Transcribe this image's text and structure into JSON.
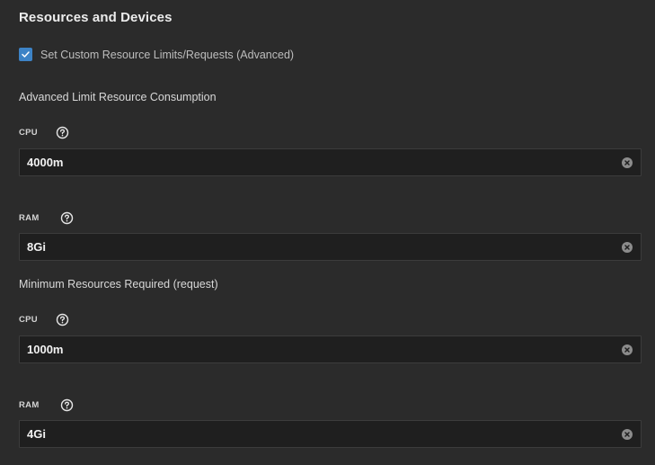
{
  "section": {
    "title": "Resources and Devices"
  },
  "custom_limits": {
    "label": "Set Custom Resource Limits/Requests (Advanced)",
    "checked": true
  },
  "limits": {
    "heading": "Advanced Limit Resource Consumption",
    "cpu": {
      "label": "CPU",
      "value": "4000m"
    },
    "ram": {
      "label": "RAM",
      "value": "8Gi"
    }
  },
  "requests": {
    "heading": "Minimum Resources Required (request)",
    "cpu": {
      "label": "CPU",
      "value": "1000m"
    },
    "ram": {
      "label": "RAM",
      "value": "4Gi"
    }
  },
  "icons": {
    "help": "help-circle-icon",
    "clear": "clear-circle-icon",
    "check": "check-icon"
  },
  "colors": {
    "background": "#2b2b2b",
    "input_background": "#1f1f1f",
    "accent": "#3d83c6"
  }
}
